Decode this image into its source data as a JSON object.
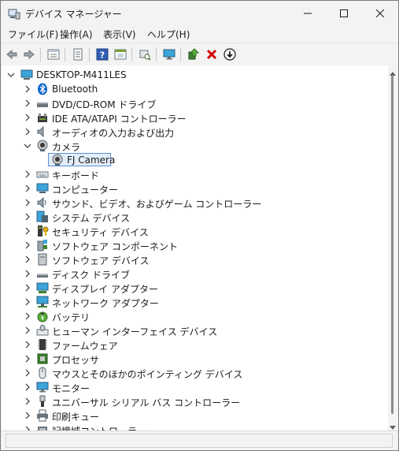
{
  "window": {
    "title": "デバイス マネージャー"
  },
  "menu": [
    {
      "label": "ファイル(F)"
    },
    {
      "label": "操作(A)"
    },
    {
      "label": "表示(V)"
    },
    {
      "label": "ヘルプ(H)"
    }
  ],
  "toolbar": [
    "back-icon",
    "forward-icon",
    "properties-icon",
    "print-icon",
    "help-icon",
    "view-icon",
    "scan-icon",
    "monitor-icon",
    "enable-device-icon",
    "uninstall-icon",
    "download-driver-icon"
  ],
  "tree": {
    "root": "DESKTOP-M411LES",
    "items": [
      {
        "label": "Bluetooth"
      },
      {
        "label": "DVD/CD-ROM ドライブ"
      },
      {
        "label": "IDE ATA/ATAPI コントローラー"
      },
      {
        "label": "オーディオの入力および出力"
      },
      {
        "label": "カメラ",
        "expanded": true,
        "children": [
          {
            "label": "FJ Camera",
            "selected": true
          }
        ]
      },
      {
        "label": "キーボード"
      },
      {
        "label": "コンピューター"
      },
      {
        "label": "サウンド、ビデオ、およびゲーム コントローラー"
      },
      {
        "label": "システム デバイス"
      },
      {
        "label": "セキュリティ デバイス"
      },
      {
        "label": "ソフトウェア コンポーネント"
      },
      {
        "label": "ソフトウェア デバイス"
      },
      {
        "label": "ディスク ドライブ"
      },
      {
        "label": "ディスプレイ アダプター"
      },
      {
        "label": "ネットワーク アダプター"
      },
      {
        "label": "バッテリ"
      },
      {
        "label": "ヒューマン インターフェイス デバイス"
      },
      {
        "label": "ファームウェア"
      },
      {
        "label": "プロセッサ"
      },
      {
        "label": "マウスとそのほかのポインティング デバイス"
      },
      {
        "label": "モニター"
      },
      {
        "label": "ユニバーサル シリアル バス コントローラー"
      },
      {
        "label": "印刷キュー"
      },
      {
        "label": "記憶域コントローラー"
      }
    ]
  },
  "colors": {
    "selection_border": "#5a8fd6",
    "selection_fill": "#e3eefb",
    "bluetooth": "#0a62c9",
    "uninstall": "#d40000"
  }
}
